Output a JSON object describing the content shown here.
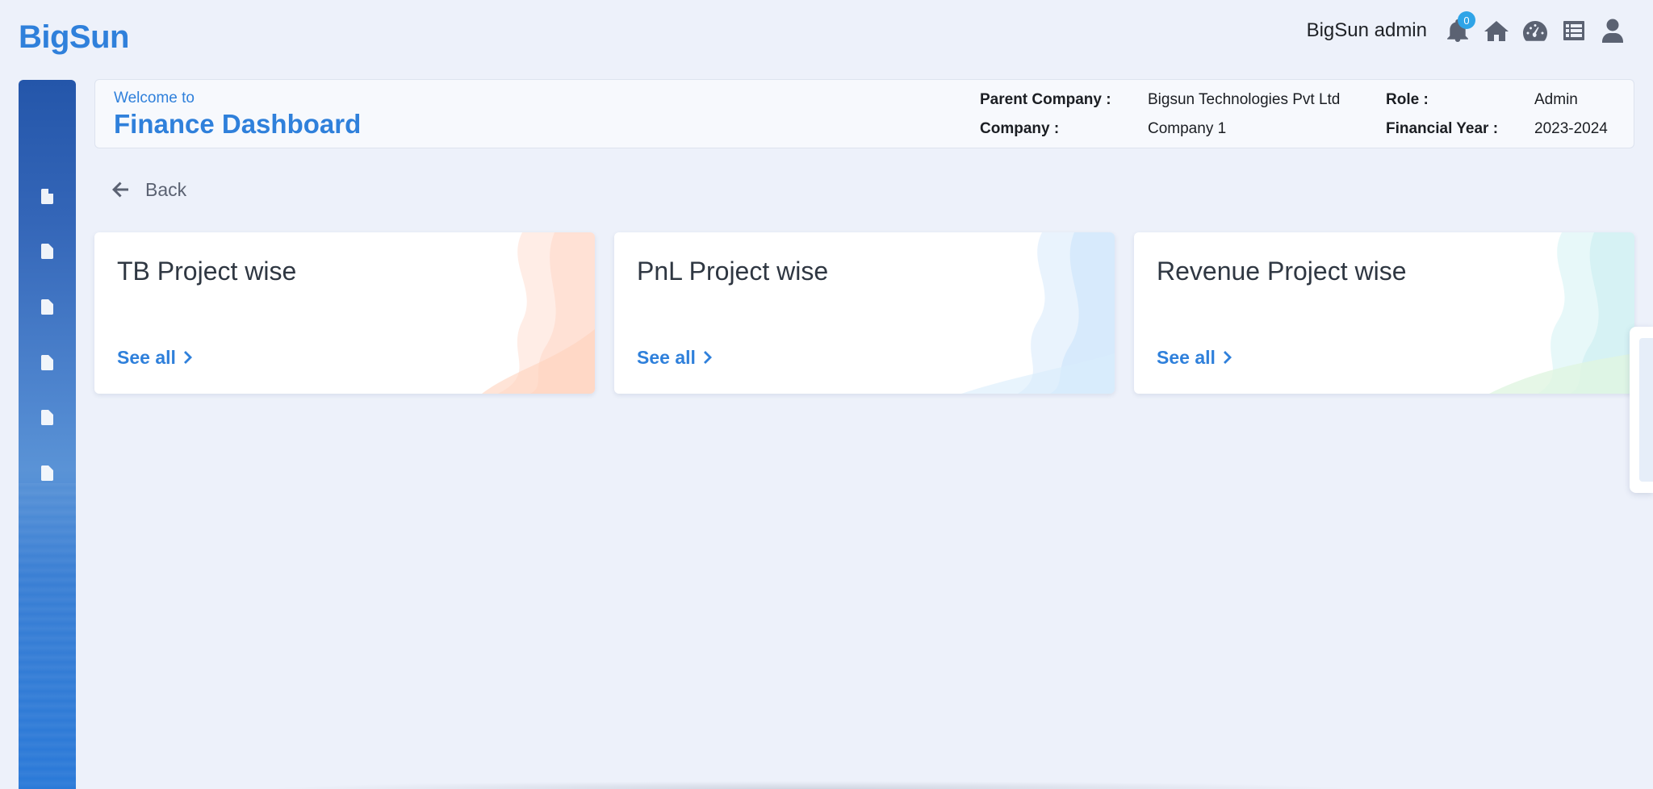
{
  "app": {
    "logo": "BigSun"
  },
  "topbar": {
    "username": "BigSun admin",
    "notification_count": "0",
    "icons": [
      "bell-icon",
      "home-icon",
      "tachometer-icon",
      "list-icon",
      "user-icon"
    ]
  },
  "sidebar": {
    "items": [
      {
        "icon": "document-icon"
      },
      {
        "icon": "document-icon"
      },
      {
        "icon": "document-icon"
      },
      {
        "icon": "document-icon"
      },
      {
        "icon": "document-icon"
      },
      {
        "icon": "document-icon"
      }
    ]
  },
  "header": {
    "welcome": "Welcome to",
    "title": "Finance Dashboard",
    "parent_company_label": "Parent Company :",
    "parent_company_value": "Bigsun Technologies Pvt Ltd",
    "company_label": "Company :",
    "company_value": "Company 1",
    "role_label": "Role :",
    "role_value": "Admin",
    "fy_label": "Financial Year :",
    "fy_value": "2023-2024"
  },
  "nav": {
    "back_label": "Back"
  },
  "cards": [
    {
      "title": "TB Project wise",
      "link": "See all",
      "accent": "#ffd9c9"
    },
    {
      "title": "PnL Project wise",
      "link": "See all",
      "accent": "#cfe6fb"
    },
    {
      "title": "Revenue Project wise",
      "link": "See all",
      "accent": "#cfeff2"
    }
  ],
  "colors": {
    "brand": "#2f80db",
    "background": "#edf1fa",
    "badge": "#2fa4e7"
  }
}
